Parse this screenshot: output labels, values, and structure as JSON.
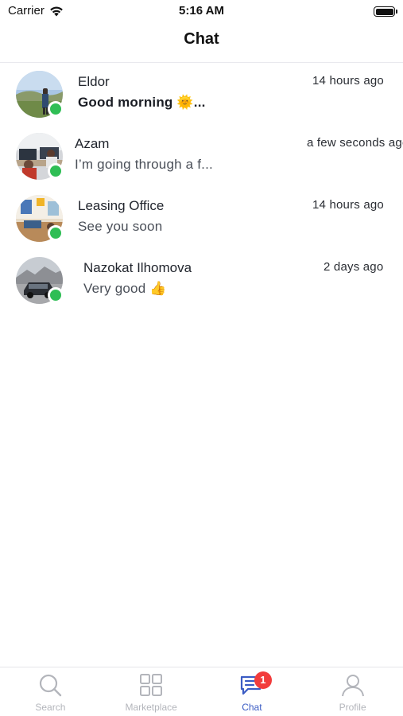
{
  "status_bar": {
    "carrier": "Carrier",
    "time": "5:16 AM"
  },
  "header": {
    "title": "Chat"
  },
  "chats": [
    {
      "name": "Eldor",
      "message": "Good morning 🌞...",
      "time": "14 hours ago",
      "unread": true,
      "online": true
    },
    {
      "name": "Azam",
      "message": "I’m going through a f...",
      "time": "a few seconds ago",
      "unread": false,
      "online": true
    },
    {
      "name": "Leasing Office",
      "message": "See you soon",
      "time": "14 hours ago",
      "unread": false,
      "online": true
    },
    {
      "name": "Nazokat Ilhomova",
      "message": "Very good 👍",
      "time": "2 days ago",
      "unread": false,
      "online": true
    }
  ],
  "tab_bar": {
    "tabs": [
      {
        "label": "Search",
        "icon": "search-icon"
      },
      {
        "label": "Marketplace",
        "icon": "grid-icon"
      },
      {
        "label": "Chat",
        "icon": "chat-icon",
        "badge": "1",
        "active": true
      },
      {
        "label": "Profile",
        "icon": "person-icon"
      }
    ]
  },
  "colors": {
    "accent": "#3b5cc4",
    "online": "#2fbe55",
    "badge": "#f23c3c",
    "inactive_tab": "#b3b5bb"
  }
}
